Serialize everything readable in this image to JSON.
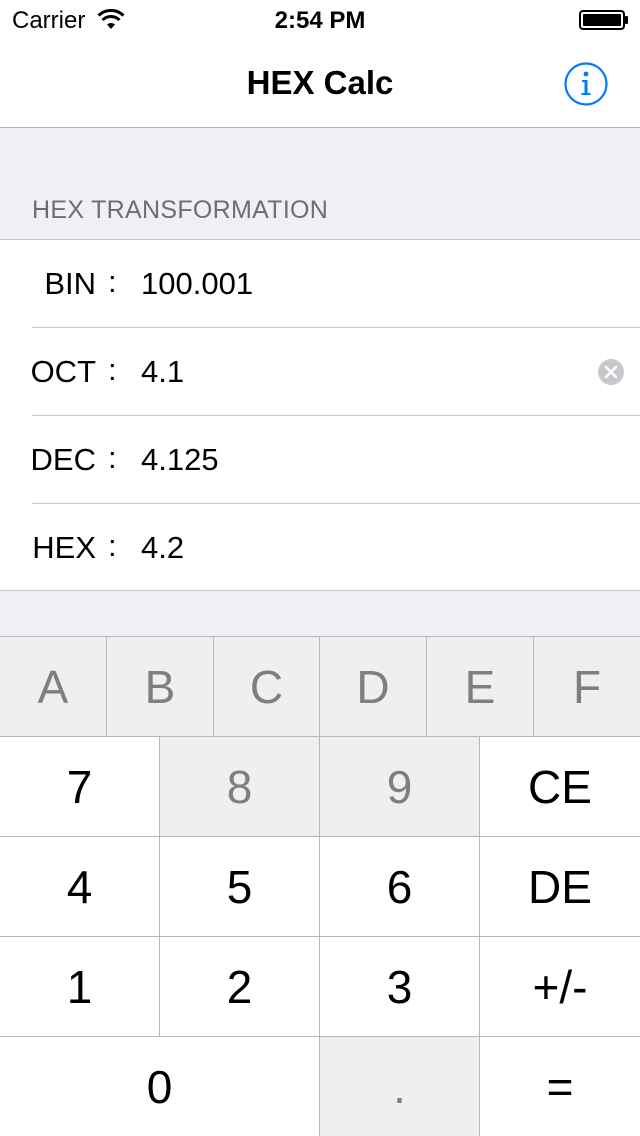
{
  "status_bar": {
    "carrier": "Carrier",
    "time": "2:54 PM"
  },
  "nav": {
    "title": "HEX Calc"
  },
  "section": {
    "header": "HEX TRANSFORMATION"
  },
  "rows": [
    {
      "label": "BIN",
      "colon": ":",
      "value": "100.001"
    },
    {
      "label": "OCT",
      "colon": ":",
      "value": "4.1"
    },
    {
      "label": "DEC",
      "colon": ":",
      "value": "4.125"
    },
    {
      "label": "HEX",
      "colon": ":",
      "value": "4.2"
    }
  ],
  "keypad": {
    "hex_keys": [
      "A",
      "B",
      "C",
      "D",
      "E",
      "F"
    ],
    "row1": [
      "7",
      "8",
      "9",
      "CE"
    ],
    "row2": [
      "4",
      "5",
      "6",
      "DE"
    ],
    "row3": [
      "1",
      "2",
      "3",
      "+/-"
    ],
    "row4": [
      "0",
      ".",
      "="
    ]
  },
  "colors": {
    "accent": "#007aff",
    "disabled_key_bg": "#efefef",
    "disabled_key_text": "#7f7f7f",
    "background": "#efeff4"
  },
  "icons": {
    "info": "info-circle-icon",
    "clear": "clear-circle-icon",
    "wifi": "wifi-icon",
    "battery": "battery-icon"
  }
}
